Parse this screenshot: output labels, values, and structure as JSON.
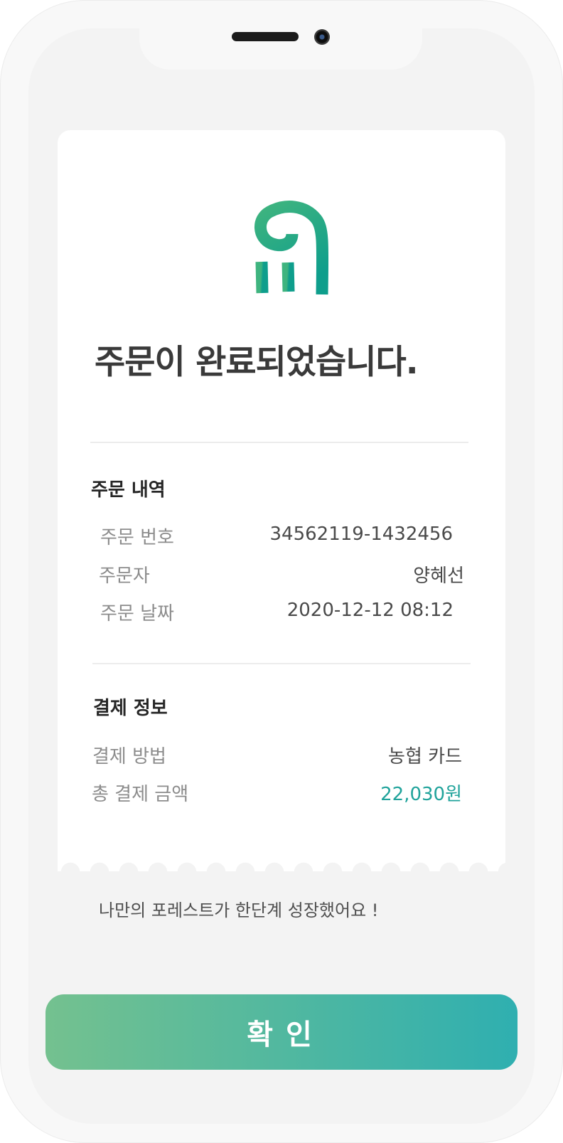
{
  "header": {
    "title": "주문이 완료되었습니다."
  },
  "order_details": {
    "section_title": "주문 내역",
    "rows": [
      {
        "label": "주문 번호",
        "value": "34562119-1432456"
      },
      {
        "label": "주문자",
        "value": "양혜선"
      },
      {
        "label": "주문 날짜",
        "value": "2020-12-12 08:12"
      }
    ]
  },
  "payment_info": {
    "section_title": "결제 정보",
    "rows": [
      {
        "label": "결제 방법",
        "value": "농협 카드"
      },
      {
        "label": "총 결제 금액",
        "value": "22,030원"
      }
    ]
  },
  "growth_message": "나만의 포레스트가 한단계 성장했어요 !",
  "confirm_button": {
    "label": "확인"
  },
  "colors": {
    "accent": "#20a39b",
    "gradient_start": "#74c18f",
    "gradient_end": "#2fafb0"
  },
  "icons": {
    "logo": "fork-leaf-logo-icon"
  }
}
